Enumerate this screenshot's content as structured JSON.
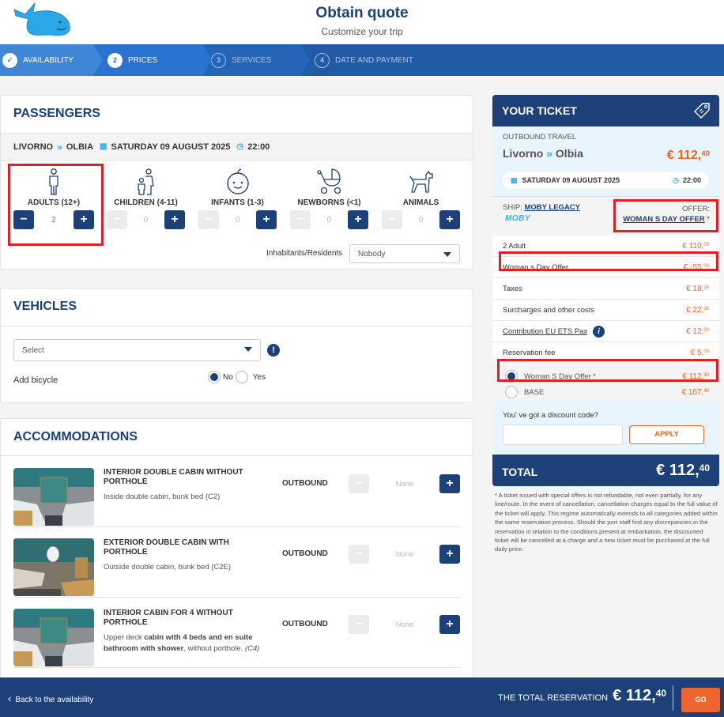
{
  "header": {
    "title": "Obtain quote",
    "subtitle": "Customize your trip",
    "logo": "whale-logo"
  },
  "steps": [
    {
      "num": "✓",
      "label": "AVAILABILITY",
      "state": "done"
    },
    {
      "num": "2",
      "label": "PRICES",
      "state": "active"
    },
    {
      "num": "3",
      "label": "SERVICES",
      "state": "pending"
    },
    {
      "num": "4",
      "label": "DATE AND PAYMENT",
      "state": "pending"
    }
  ],
  "passengers": {
    "title": "PASSENGERS",
    "route": {
      "from": "LIVORNO",
      "to": "OLBIA",
      "date": "SATURDAY 09 AUGUST 2025",
      "time": "22:00"
    },
    "types": [
      {
        "label": "ADULTS (12+)",
        "value": "2",
        "icon": "adult-icon"
      },
      {
        "label": "CHILDREN (4-11)",
        "value": "0",
        "icon": "child-icon"
      },
      {
        "label": "INFANTS (1-3)",
        "value": "0",
        "icon": "infant-icon"
      },
      {
        "label": "NEWBORNS (<1)",
        "value": "0",
        "icon": "stroller-icon"
      },
      {
        "label": "ANIMALS",
        "value": "0",
        "icon": "dog-icon"
      }
    ],
    "minus": "−",
    "plus": "+",
    "residents_label": "Inhabitants/Residents",
    "residents_value": "Nobody"
  },
  "vehicles": {
    "title": "VEHICLES",
    "select_value": "Select",
    "alert": "!",
    "bicycle_label": "Add bicycle",
    "no_label": "No",
    "yes_label": "Yes"
  },
  "accommodations": {
    "title": "ACCOMMODATIONS",
    "items": [
      {
        "name": "INTERIOR DOUBLE CABIN WITHOUT PORTHOLE",
        "desc": "Inside double cabin, bunk bed (C2)",
        "direction": "OUTBOUND",
        "value": "None"
      },
      {
        "name": "EXTERIOR DOUBLE CABIN WITH PORTHOLE",
        "desc": "Outside double cabin, bunk bed (C2E)",
        "direction": "OUTBOUND",
        "value": "None"
      },
      {
        "name": "INTERIOR CABIN FOR 4 WITHOUT PORTHOLE",
        "desc_pre": "Upper deck ",
        "desc_bold": "cabin with 4 beds and en suite bathroom with shower",
        "desc_post": ", without porthole. ",
        "desc_code": "(C4)",
        "direction": "OUTBOUND",
        "value": "None"
      }
    ]
  },
  "ticket": {
    "title": "YOUR TICKET",
    "outbound_caption": "OUTBOUND TRAVEL",
    "from": "Livorno",
    "to": "Olbia",
    "price_int": "€ 112,",
    "price_dec": "40",
    "date": "SATURDAY 09 AUGUST 2025",
    "time": "22:00",
    "ship_label": "SHIP:",
    "ship_name": "MOBY LEGACY",
    "ship_brand": "MOBY",
    "offer_label": "OFFER:",
    "offer_name": "WOMAN S DAY OFFER",
    "offer_star": " *",
    "lines": [
      {
        "label": "2 Adult",
        "int": "€ 110,",
        "dec": "00"
      },
      {
        "label": "Woman s Day Offer",
        "int": "€ -55,",
        "dec": "00"
      },
      {
        "label": "Taxes",
        "int": "€ 18,",
        "dec": "24"
      },
      {
        "label": "Surcharges and other costs",
        "int": "€ 22,",
        "dec": "16"
      },
      {
        "label": "Contribution EU ETS Pax",
        "int": "€ 12,",
        "dec": "00"
      },
      {
        "label": "Reservation fee",
        "int": "€ 5,",
        "dec": "00"
      }
    ],
    "fare_options": [
      {
        "label": "Woman S Day Offer *",
        "int": "€ 112,",
        "dec": "40",
        "selected": true
      },
      {
        "label": "BASE",
        "int": "€ 167,",
        "dec": "40",
        "selected": false
      }
    ],
    "discount_label": "You' ve got a discount code?",
    "discount_value": "",
    "apply_label": "APPLY",
    "total_label": "TOTAL",
    "total_int": "€ 112,",
    "total_dec": "40",
    "note": "* A ticket issued with special offers is not refundable, not even partially, for any line/route. In the event of cancellation, cancellation charges equal to the full value of the ticket will apply. This regime automatically extends to all categories added within the same reservation process. Should the port staff find any discrepancies in the reservation in relation to the conditions present at embarkation, the discounted ticket will be cancelled at a charge and a new ticket must be purchased at the full daily price."
  },
  "footer": {
    "back_label": "Back to the availability",
    "total_label": "THE TOTAL RESERVATION",
    "total_int": "€ 112,",
    "total_dec": "40",
    "go_label": "GO"
  },
  "colors": {
    "brand_navy": "#1b4178",
    "accent_orange": "#ee6530",
    "accent_blue": "#3aaee8",
    "highlight_red": "#e41e26"
  }
}
